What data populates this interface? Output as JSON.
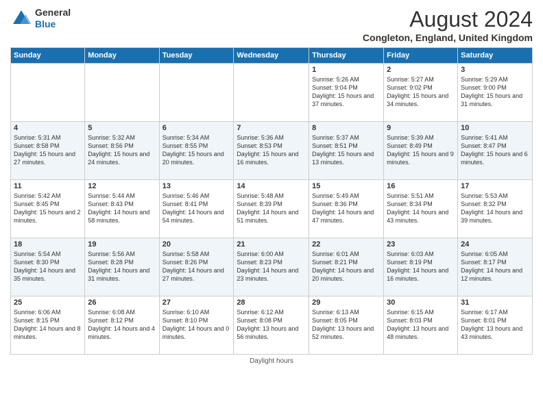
{
  "logo": {
    "general": "General",
    "blue": "Blue"
  },
  "title": "August 2024",
  "location": "Congleton, England, United Kingdom",
  "days_of_week": [
    "Sunday",
    "Monday",
    "Tuesday",
    "Wednesday",
    "Thursday",
    "Friday",
    "Saturday"
  ],
  "weeks": [
    [
      {
        "day": "",
        "info": ""
      },
      {
        "day": "",
        "info": ""
      },
      {
        "day": "",
        "info": ""
      },
      {
        "day": "",
        "info": ""
      },
      {
        "day": "1",
        "info": "Sunrise: 5:26 AM\nSunset: 9:04 PM\nDaylight: 15 hours and 37 minutes."
      },
      {
        "day": "2",
        "info": "Sunrise: 5:27 AM\nSunset: 9:02 PM\nDaylight: 15 hours and 34 minutes."
      },
      {
        "day": "3",
        "info": "Sunrise: 5:29 AM\nSunset: 9:00 PM\nDaylight: 15 hours and 31 minutes."
      }
    ],
    [
      {
        "day": "4",
        "info": "Sunrise: 5:31 AM\nSunset: 8:58 PM\nDaylight: 15 hours and 27 minutes."
      },
      {
        "day": "5",
        "info": "Sunrise: 5:32 AM\nSunset: 8:56 PM\nDaylight: 15 hours and 24 minutes."
      },
      {
        "day": "6",
        "info": "Sunrise: 5:34 AM\nSunset: 8:55 PM\nDaylight: 15 hours and 20 minutes."
      },
      {
        "day": "7",
        "info": "Sunrise: 5:36 AM\nSunset: 8:53 PM\nDaylight: 15 hours and 16 minutes."
      },
      {
        "day": "8",
        "info": "Sunrise: 5:37 AM\nSunset: 8:51 PM\nDaylight: 15 hours and 13 minutes."
      },
      {
        "day": "9",
        "info": "Sunrise: 5:39 AM\nSunset: 8:49 PM\nDaylight: 15 hours and 9 minutes."
      },
      {
        "day": "10",
        "info": "Sunrise: 5:41 AM\nSunset: 8:47 PM\nDaylight: 15 hours and 6 minutes."
      }
    ],
    [
      {
        "day": "11",
        "info": "Sunrise: 5:42 AM\nSunset: 8:45 PM\nDaylight: 15 hours and 2 minutes."
      },
      {
        "day": "12",
        "info": "Sunrise: 5:44 AM\nSunset: 8:43 PM\nDaylight: 14 hours and 58 minutes."
      },
      {
        "day": "13",
        "info": "Sunrise: 5:46 AM\nSunset: 8:41 PM\nDaylight: 14 hours and 54 minutes."
      },
      {
        "day": "14",
        "info": "Sunrise: 5:48 AM\nSunset: 8:39 PM\nDaylight: 14 hours and 51 minutes."
      },
      {
        "day": "15",
        "info": "Sunrise: 5:49 AM\nSunset: 8:36 PM\nDaylight: 14 hours and 47 minutes."
      },
      {
        "day": "16",
        "info": "Sunrise: 5:51 AM\nSunset: 8:34 PM\nDaylight: 14 hours and 43 minutes."
      },
      {
        "day": "17",
        "info": "Sunrise: 5:53 AM\nSunset: 8:32 PM\nDaylight: 14 hours and 39 minutes."
      }
    ],
    [
      {
        "day": "18",
        "info": "Sunrise: 5:54 AM\nSunset: 8:30 PM\nDaylight: 14 hours and 35 minutes."
      },
      {
        "day": "19",
        "info": "Sunrise: 5:56 AM\nSunset: 8:28 PM\nDaylight: 14 hours and 31 minutes."
      },
      {
        "day": "20",
        "info": "Sunrise: 5:58 AM\nSunset: 8:26 PM\nDaylight: 14 hours and 27 minutes."
      },
      {
        "day": "21",
        "info": "Sunrise: 6:00 AM\nSunset: 8:23 PM\nDaylight: 14 hours and 23 minutes."
      },
      {
        "day": "22",
        "info": "Sunrise: 6:01 AM\nSunset: 8:21 PM\nDaylight: 14 hours and 20 minutes."
      },
      {
        "day": "23",
        "info": "Sunrise: 6:03 AM\nSunset: 8:19 PM\nDaylight: 14 hours and 16 minutes."
      },
      {
        "day": "24",
        "info": "Sunrise: 6:05 AM\nSunset: 8:17 PM\nDaylight: 14 hours and 12 minutes."
      }
    ],
    [
      {
        "day": "25",
        "info": "Sunrise: 6:06 AM\nSunset: 8:15 PM\nDaylight: 14 hours and 8 minutes."
      },
      {
        "day": "26",
        "info": "Sunrise: 6:08 AM\nSunset: 8:12 PM\nDaylight: 14 hours and 4 minutes."
      },
      {
        "day": "27",
        "info": "Sunrise: 6:10 AM\nSunset: 8:10 PM\nDaylight: 14 hours and 0 minutes."
      },
      {
        "day": "28",
        "info": "Sunrise: 6:12 AM\nSunset: 8:08 PM\nDaylight: 13 hours and 56 minutes."
      },
      {
        "day": "29",
        "info": "Sunrise: 6:13 AM\nSunset: 8:05 PM\nDaylight: 13 hours and 52 minutes."
      },
      {
        "day": "30",
        "info": "Sunrise: 6:15 AM\nSunset: 8:03 PM\nDaylight: 13 hours and 48 minutes."
      },
      {
        "day": "31",
        "info": "Sunrise: 6:17 AM\nSunset: 8:01 PM\nDaylight: 13 hours and 43 minutes."
      }
    ]
  ],
  "footer": "Daylight hours"
}
